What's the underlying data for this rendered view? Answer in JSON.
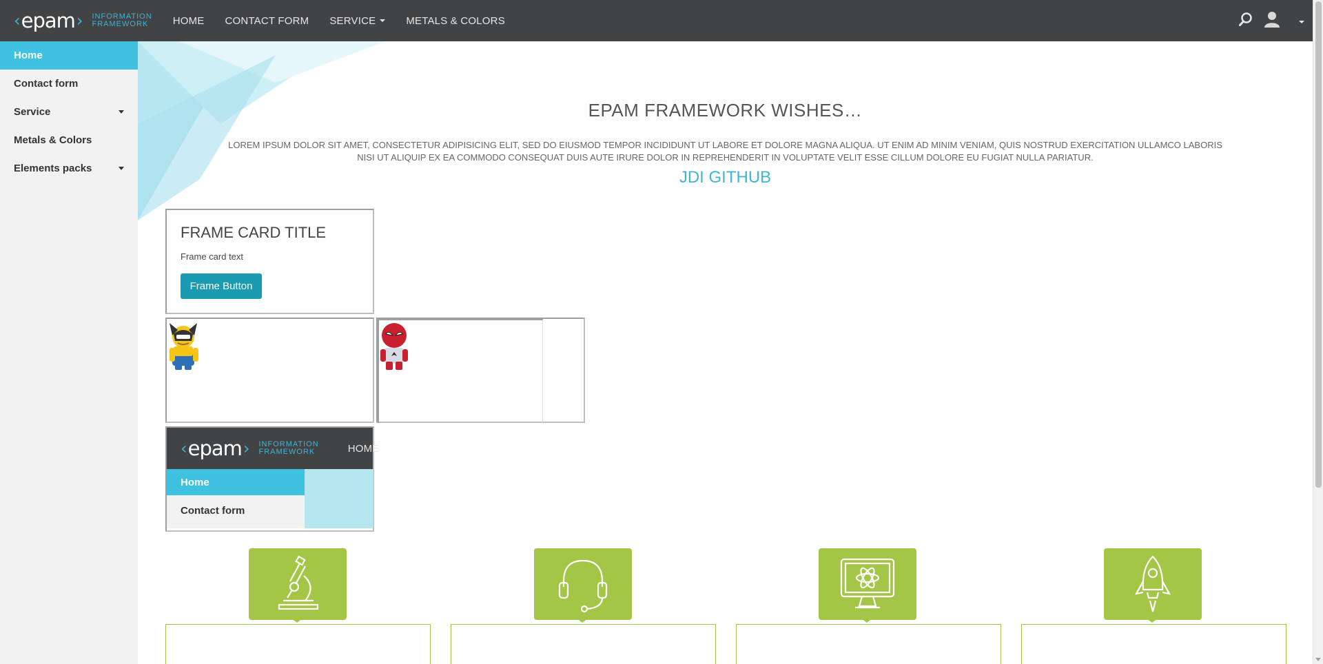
{
  "header": {
    "logo_text": "epam",
    "logo_sub_line1": "INFORMATION",
    "logo_sub_line2": "FRAMEWORK",
    "nav": [
      {
        "label": "HOME"
      },
      {
        "label": "CONTACT FORM"
      },
      {
        "label": "SERVICE",
        "has_dropdown": true
      },
      {
        "label": "METALS & COLORS"
      }
    ],
    "icons": [
      "search-icon",
      "user-icon",
      "caret-down-icon"
    ]
  },
  "sidebar": {
    "items": [
      {
        "label": "Home",
        "active": true
      },
      {
        "label": "Contact form"
      },
      {
        "label": "Service",
        "has_dropdown": true
      },
      {
        "label": "Metals & Colors"
      },
      {
        "label": "Elements packs",
        "has_dropdown": true
      }
    ]
  },
  "main": {
    "headline": "EPAM FRAMEWORK WISHES…",
    "lorem": "LOREM IPSUM DOLOR SIT AMET, CONSECTETUR ADIPISICING ELIT, SED DO EIUSMOD TEMPOR INCIDIDUNT UT LABORE ET DOLORE MAGNA ALIQUA. UT ENIM AD MINIM VENIAM, QUIS NOSTRUD EXERCITATION ULLAMCO LABORIS NISI UT ALIQUIP EX EA COMMODO CONSEQUAT DUIS AUTE IRURE DOLOR IN REPREHENDERIT IN VOLUPTATE VELIT ESSE CILLUM DOLORE EU FUGIAT NULLA PARIATUR.",
    "github_link": "JDI GITHUB"
  },
  "frame_card": {
    "title": "FRAME CARD TITLE",
    "text": "Frame card text",
    "button": "Frame Button"
  },
  "mini_frame": {
    "logo_text": "epam",
    "logo_sub_line1": "INFORMATION",
    "logo_sub_line2": "FRAMEWORK",
    "nav_home": "HOME",
    "items": [
      {
        "label": "Home",
        "active": true
      },
      {
        "label": "Contact form"
      }
    ]
  },
  "benefits": {
    "icons": [
      "microscope-icon",
      "headset-icon",
      "monitor-atom-icon",
      "rocket-icon"
    ]
  },
  "colors": {
    "topbar": "#424345",
    "accent": "#3fc2e0",
    "button": "#1a9bb1",
    "benefit_green": "#a4c646"
  }
}
